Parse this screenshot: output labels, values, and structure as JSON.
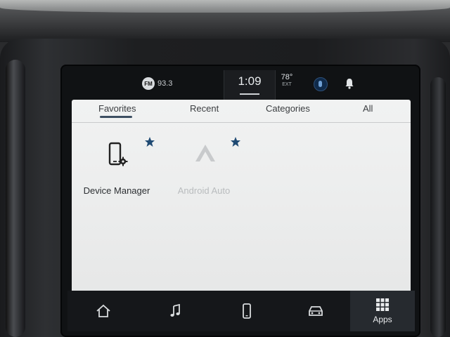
{
  "status_bar": {
    "radio_band": "FM",
    "radio_frequency": "93.3",
    "clock": "1:09",
    "outside_temp": "78°",
    "temp_label": "EXT",
    "icons": [
      "siriusxm-icon",
      "bell-icon"
    ]
  },
  "tabs": [
    {
      "label": "Favorites",
      "active": true
    },
    {
      "label": "Recent",
      "active": false
    },
    {
      "label": "Categories",
      "active": false
    },
    {
      "label": "All",
      "active": false
    }
  ],
  "apps": [
    {
      "label": "Device Manager",
      "icon": "phone-gear-icon",
      "favorite": true,
      "enabled": true
    },
    {
      "label": "Android Auto",
      "icon": "android-auto-icon",
      "favorite": true,
      "enabled": false
    }
  ],
  "nav": {
    "items": [
      "home-icon",
      "music-icon",
      "phone-icon",
      "vehicle-icon",
      "apps-grid-icon"
    ],
    "apps_label": "Apps"
  },
  "colors": {
    "accent_star": "#1f4a73",
    "panel_bg": "#efefef",
    "nav_bg": "#15171a"
  }
}
